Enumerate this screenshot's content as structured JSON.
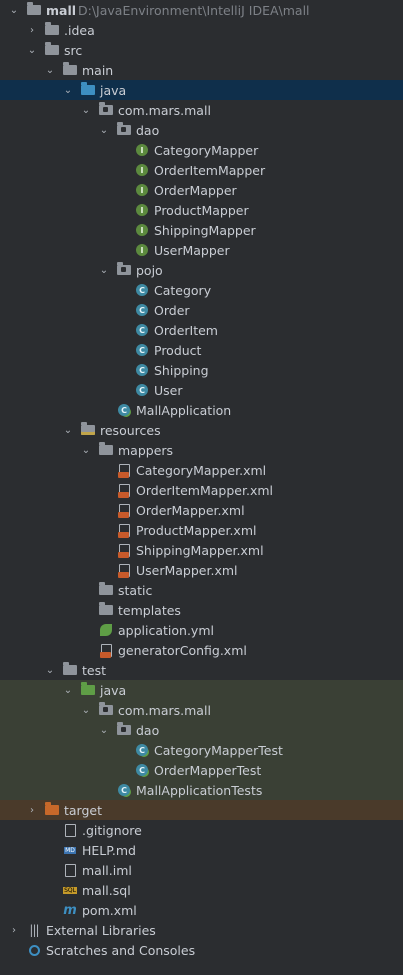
{
  "tree": [
    {
      "name": "tree-item-mall",
      "depth": 0,
      "arrow": "open",
      "icon": "folder",
      "icon_color": "#8f949b",
      "label": "mall",
      "bold": true,
      "hint": "D:\\JavaEnvironment\\IntelliJ IDEA\\mall"
    },
    {
      "name": "tree-item-idea",
      "depth": 1,
      "arrow": "closed",
      "icon": "folder",
      "icon_color": "#8f949b",
      "label": ".idea"
    },
    {
      "name": "tree-item-src",
      "depth": 1,
      "arrow": "open",
      "icon": "folder",
      "icon_color": "#8f949b",
      "label": "src"
    },
    {
      "name": "tree-item-main",
      "depth": 2,
      "arrow": "open",
      "icon": "folder",
      "icon_color": "#8f949b",
      "label": "main"
    },
    {
      "name": "tree-item-java",
      "depth": 3,
      "arrow": "open",
      "icon": "folder",
      "icon_color": "#3d8fc2",
      "label": "java",
      "state": "sel"
    },
    {
      "name": "tree-item-com-mars-mall",
      "depth": 4,
      "arrow": "open",
      "icon": "package",
      "icon_color": "#8f949b",
      "label": "com.mars.mall"
    },
    {
      "name": "tree-item-dao",
      "depth": 5,
      "arrow": "open",
      "icon": "package",
      "icon_color": "#8f949b",
      "label": "dao"
    },
    {
      "name": "tree-item-categorymapper",
      "depth": 6,
      "icon": "interface",
      "label": "CategoryMapper"
    },
    {
      "name": "tree-item-orderitemmapper",
      "depth": 6,
      "icon": "interface",
      "label": "OrderItemMapper"
    },
    {
      "name": "tree-item-ordermapper",
      "depth": 6,
      "icon": "interface",
      "label": "OrderMapper"
    },
    {
      "name": "tree-item-productmapper",
      "depth": 6,
      "icon": "interface",
      "label": "ProductMapper"
    },
    {
      "name": "tree-item-shippingmapper",
      "depth": 6,
      "icon": "interface",
      "label": "ShippingMapper"
    },
    {
      "name": "tree-item-usermapper",
      "depth": 6,
      "icon": "interface",
      "label": "UserMapper"
    },
    {
      "name": "tree-item-pojo",
      "depth": 5,
      "arrow": "open",
      "icon": "package",
      "icon_color": "#8f949b",
      "label": "pojo"
    },
    {
      "name": "tree-item-category",
      "depth": 6,
      "icon": "class",
      "label": "Category"
    },
    {
      "name": "tree-item-order",
      "depth": 6,
      "icon": "class",
      "label": "Order"
    },
    {
      "name": "tree-item-orderitem",
      "depth": 6,
      "icon": "class",
      "label": "OrderItem"
    },
    {
      "name": "tree-item-product",
      "depth": 6,
      "icon": "class",
      "label": "Product"
    },
    {
      "name": "tree-item-shipping",
      "depth": 6,
      "icon": "class",
      "label": "Shipping"
    },
    {
      "name": "tree-item-user",
      "depth": 6,
      "icon": "class",
      "label": "User"
    },
    {
      "name": "tree-item-mallapplication",
      "depth": 5,
      "icon": "spring-class",
      "label": "MallApplication"
    },
    {
      "name": "tree-item-resources",
      "depth": 3,
      "arrow": "open",
      "icon": "resources-folder",
      "icon_color": "#8f949b",
      "label": "resources"
    },
    {
      "name": "tree-item-mappers",
      "depth": 4,
      "arrow": "open",
      "icon": "folder",
      "icon_color": "#8f949b",
      "label": "mappers"
    },
    {
      "name": "tree-item-categorymapper-xml",
      "depth": 5,
      "icon": "xml",
      "label": "CategoryMapper.xml"
    },
    {
      "name": "tree-item-orderitemmapper-xml",
      "depth": 5,
      "icon": "xml",
      "label": "OrderItemMapper.xml"
    },
    {
      "name": "tree-item-ordermapper-xml",
      "depth": 5,
      "icon": "xml",
      "label": "OrderMapper.xml"
    },
    {
      "name": "tree-item-productmapper-xml",
      "depth": 5,
      "icon": "xml",
      "label": "ProductMapper.xml"
    },
    {
      "name": "tree-item-shippingmapper-xml",
      "depth": 5,
      "icon": "xml",
      "label": "ShippingMapper.xml"
    },
    {
      "name": "tree-item-usermapper-xml",
      "depth": 5,
      "icon": "xml",
      "label": "UserMapper.xml"
    },
    {
      "name": "tree-item-static",
      "depth": 4,
      "icon": "folder",
      "icon_color": "#8f949b",
      "label": "static"
    },
    {
      "name": "tree-item-templates",
      "depth": 4,
      "icon": "folder",
      "icon_color": "#8f949b",
      "label": "templates"
    },
    {
      "name": "tree-item-application-yml",
      "depth": 4,
      "icon": "spring-config",
      "label": "application.yml"
    },
    {
      "name": "tree-item-generatorconfig-xml",
      "depth": 4,
      "icon": "xml",
      "label": "generatorConfig.xml"
    },
    {
      "name": "tree-item-test",
      "depth": 2,
      "arrow": "open",
      "icon": "folder",
      "icon_color": "#8f949b",
      "label": "test"
    },
    {
      "name": "tree-item-test-java",
      "depth": 3,
      "arrow": "open",
      "icon": "folder",
      "icon_color": "#5f9e46",
      "label": "java",
      "state": "test"
    },
    {
      "name": "tree-item-test-com-mars-mall",
      "depth": 4,
      "arrow": "open",
      "icon": "package",
      "icon_color": "#8f949b",
      "label": "com.mars.mall",
      "state": "test"
    },
    {
      "name": "tree-item-test-dao",
      "depth": 5,
      "arrow": "open",
      "icon": "package",
      "icon_color": "#8f949b",
      "label": "dao",
      "state": "test"
    },
    {
      "name": "tree-item-categorymappertest",
      "depth": 6,
      "icon": "test-class",
      "label": "CategoryMapperTest",
      "state": "test"
    },
    {
      "name": "tree-item-ordermappertest",
      "depth": 6,
      "icon": "test-class",
      "label": "OrderMapperTest",
      "state": "test"
    },
    {
      "name": "tree-item-mallapplicationtests",
      "depth": 5,
      "icon": "test-class",
      "label": "MallApplicationTests",
      "state": "test"
    },
    {
      "name": "tree-item-target",
      "depth": 1,
      "arrow": "closed",
      "icon": "folder",
      "icon_color": "#c7682a",
      "label": "target",
      "state": "excl"
    },
    {
      "name": "tree-item-gitignore",
      "depth": 2,
      "icon": "text-file",
      "label": ".gitignore"
    },
    {
      "name": "tree-item-help-md",
      "depth": 2,
      "icon": "md-file",
      "label": "HELP.md"
    },
    {
      "name": "tree-item-mall-iml",
      "depth": 2,
      "icon": "text-file",
      "label": "mall.iml"
    },
    {
      "name": "tree-item-mall-sql",
      "depth": 2,
      "icon": "sql-file",
      "label": "mall.sql"
    },
    {
      "name": "tree-item-pom-xml",
      "depth": 2,
      "icon": "maven-file",
      "label": "pom.xml"
    },
    {
      "name": "tree-item-external-libraries",
      "depth": 0,
      "arrow": "closed",
      "icon": "libraries",
      "label": "External Libraries"
    },
    {
      "name": "tree-item-scratches",
      "depth": 0,
      "icon": "scratches",
      "label": "Scratches and Consoles"
    }
  ]
}
